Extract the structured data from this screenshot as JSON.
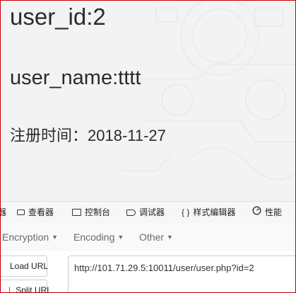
{
  "page": {
    "user_id_line": "user_id:2",
    "user_name_line": "user_name:tttt",
    "register_time_line": "注册时间：2018-11-27"
  },
  "devtools": {
    "cut_tab_label": "器",
    "tabs": [
      {
        "label": "查看器",
        "icon": "inspector-icon"
      },
      {
        "label": "控制台",
        "icon": "console-icon"
      },
      {
        "label": "调试器",
        "icon": "debugger-icon"
      },
      {
        "label": "样式编辑器",
        "icon": "style-editor-icon"
      },
      {
        "label": "性能",
        "icon": "performance-icon"
      }
    ]
  },
  "hackbar": {
    "menus": [
      "Encryption",
      "Encoding",
      "Other"
    ],
    "load_url_label": "Load URL",
    "split_url_label": "Split URL",
    "url_value": "http://101.71.29.5:10011/user/user.php?id=2"
  }
}
